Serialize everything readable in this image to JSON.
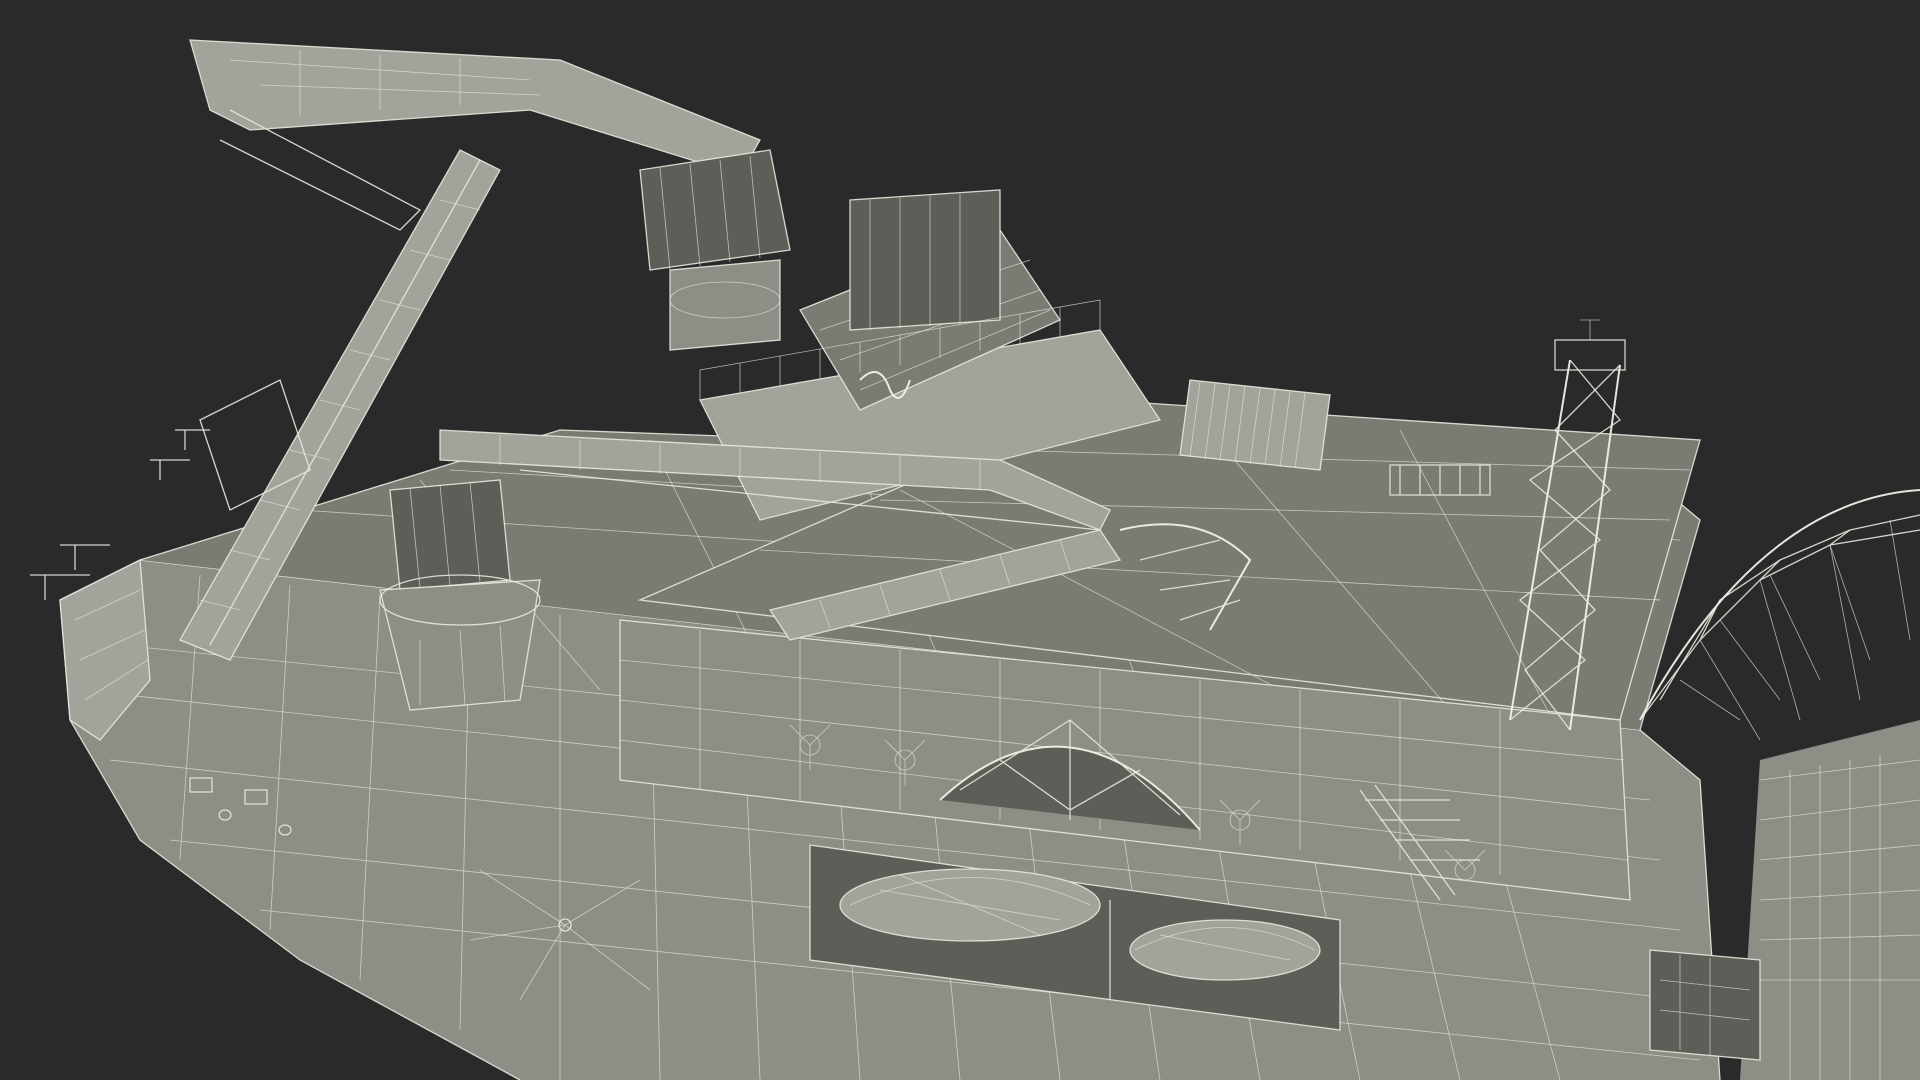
{
  "scene": {
    "subject": "ship-wireframe-render",
    "background_color": "#2a2a2a",
    "surface_color": "#8e8e86",
    "wire_color": "#e8e8de"
  }
}
